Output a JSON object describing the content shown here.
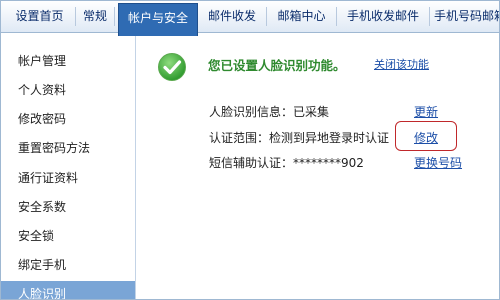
{
  "tabs": [
    {
      "label": "设置首页"
    },
    {
      "label": "常规"
    },
    {
      "label": "帐户与安全"
    },
    {
      "label": "邮件收发"
    },
    {
      "label": "邮箱中心"
    },
    {
      "label": "手机收发邮件"
    },
    {
      "label": "手机号码邮箱"
    }
  ],
  "sidebar": {
    "items": [
      {
        "label": "帐户管理"
      },
      {
        "label": "个人资料"
      },
      {
        "label": "修改密码"
      },
      {
        "label": "重置密码方法"
      },
      {
        "label": "通行证资料"
      },
      {
        "label": "安全系数"
      },
      {
        "label": "安全锁"
      },
      {
        "label": "绑定手机"
      },
      {
        "label": "人脸识别"
      }
    ],
    "active_index": 8
  },
  "main": {
    "headline": "您已设置人脸识别功能。",
    "disable_link": "关闭该功能",
    "rows": [
      {
        "label": "人脸识别信息：",
        "value": "已采集",
        "action": "更新"
      },
      {
        "label": "认证范围：",
        "value": "检测到异地登录时认证",
        "action": "修改"
      },
      {
        "label": "短信辅助认证：",
        "value": "********902",
        "action": "更换号码"
      }
    ]
  },
  "colors": {
    "accent": "#2f6bb3",
    "sidebar_active": "#7aa5d6",
    "success": "#2f8a2f",
    "link": "#1d4fa8",
    "highlight": "#c0282b"
  }
}
